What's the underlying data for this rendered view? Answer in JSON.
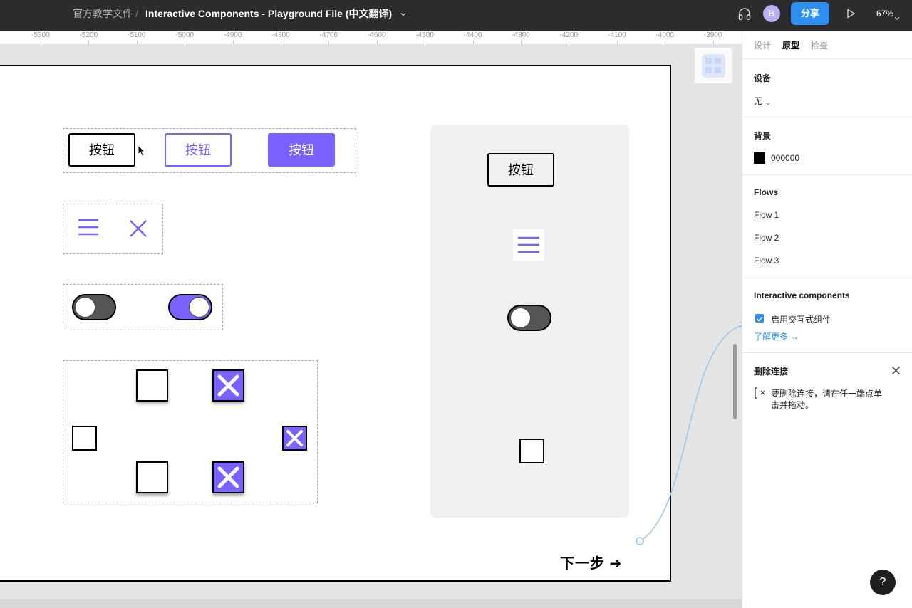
{
  "topbar": {
    "breadcrumb_parent": "官方教学文件",
    "breadcrumb_separator": "/",
    "file_name": "Interactive Components - Playground File (中文翻译)",
    "avatar_initial": "B",
    "share_label": "分享",
    "zoom_level": "67%"
  },
  "ruler": {
    "ticks": [
      "-5300",
      "-5200",
      "-5100",
      "-5000",
      "-4900",
      "-4800",
      "-4700",
      "-4600",
      "-4500",
      "-4400",
      "-4300",
      "-4200",
      "-4100",
      "-4000",
      "-3900"
    ]
  },
  "canvas": {
    "buttons": {
      "default_label": "按钮",
      "hover_label": "按钮",
      "pressed_label": "按钮"
    },
    "preview_button_label": "按钮",
    "next_step_label": "下一步 ➔",
    "colors": {
      "accent": "#7b61ff",
      "toggle_off": "#555555",
      "preview_bg": "#f0f0f0"
    }
  },
  "rightpanel": {
    "tabs": [
      "设计",
      "原型",
      "检查"
    ],
    "active_tab": "原型",
    "device": {
      "title": "设备",
      "value": "无"
    },
    "background": {
      "title": "背景",
      "value": "000000"
    },
    "flows": {
      "title": "Flows",
      "items": [
        "Flow 1",
        "Flow 2",
        "Flow 3"
      ]
    },
    "interactive": {
      "title": "Interactive components",
      "checkbox_label": "启用交互式组件",
      "learn_more": "了解更多 →"
    },
    "delete_connection": {
      "title": "删除连接",
      "hint": "要删除连接，请在任一端点单击并拖动。"
    }
  },
  "help_label": "?"
}
